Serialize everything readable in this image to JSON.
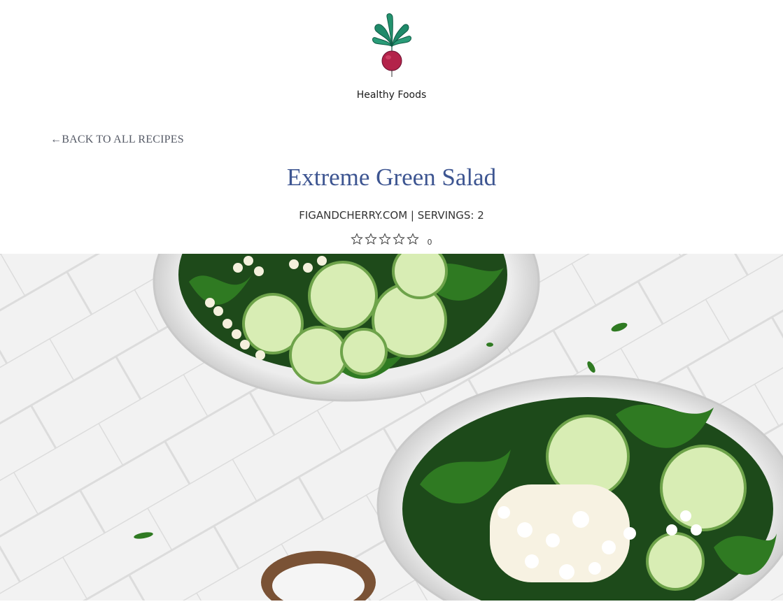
{
  "site": {
    "name": "Healthy Foods",
    "logo_icon": "radish-icon"
  },
  "nav": {
    "back_label": "←BACK TO ALL RECIPES"
  },
  "recipe": {
    "title": "Extreme Green Salad",
    "meta": "FIGANDCHERRY.COM | SERVINGS: 2",
    "rating": {
      "stars_filled": 0,
      "stars_total": 5,
      "count": "0"
    },
    "hero_image": "salad-bowls-photo"
  },
  "colors": {
    "title": "#3d5591",
    "back_link": "#555a66",
    "leaf_green": "#1f8a6a",
    "radish": "#b3234a"
  }
}
